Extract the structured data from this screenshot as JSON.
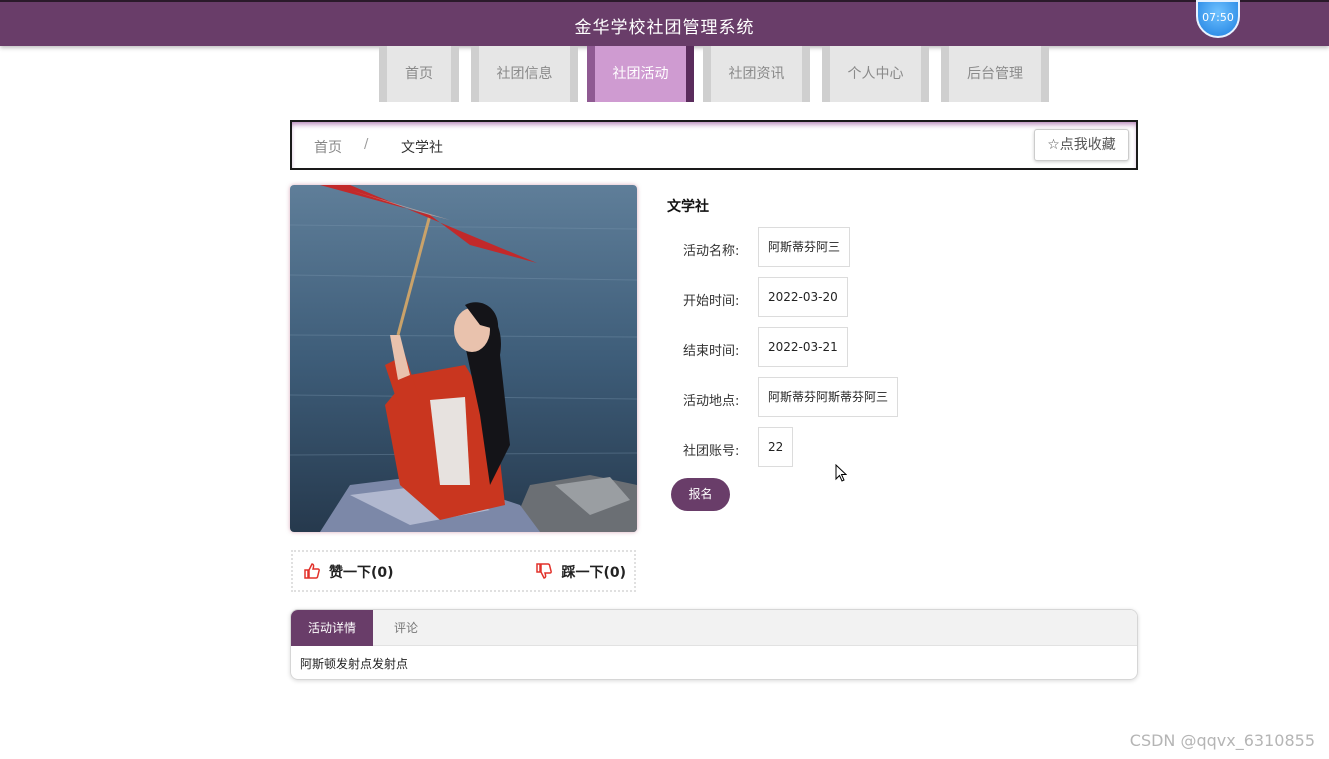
{
  "header": {
    "title": "金华学校社团管理系统",
    "clock": "07:50"
  },
  "nav": {
    "items": [
      {
        "label": "首页"
      },
      {
        "label": "社团信息"
      },
      {
        "label": "社团活动",
        "active": true
      },
      {
        "label": "社团资讯"
      },
      {
        "label": "个人中心"
      },
      {
        "label": "后台管理"
      }
    ]
  },
  "breadcrumb": {
    "home": "首页",
    "separator": "/",
    "current": "文学社",
    "favorite_label": "点我收藏"
  },
  "detail": {
    "club_name": "文学社",
    "fields": [
      {
        "label": "活动名称:",
        "value": "阿斯蒂芬阿三"
      },
      {
        "label": "开始时间:",
        "value": "2022-03-20"
      },
      {
        "label": "结束时间:",
        "value": "2022-03-21"
      },
      {
        "label": "活动地点:",
        "value": "阿斯蒂芬阿斯蒂芬阿三"
      },
      {
        "label": "社团账号:",
        "value": "22"
      }
    ],
    "signup_label": "报名"
  },
  "votes": {
    "like_label": "赞一下(0)",
    "dislike_label": "踩一下(0)"
  },
  "tabs": {
    "items": [
      {
        "label": "活动详情",
        "active": true
      },
      {
        "label": "评论"
      }
    ],
    "content": "阿斯顿发射点发射点"
  },
  "watermark": "CSDN @qqvx_6310855",
  "colors": {
    "primary": "#693d69",
    "nav_active": "#cf9bd1",
    "clock_blue": "#1d7fe0"
  }
}
